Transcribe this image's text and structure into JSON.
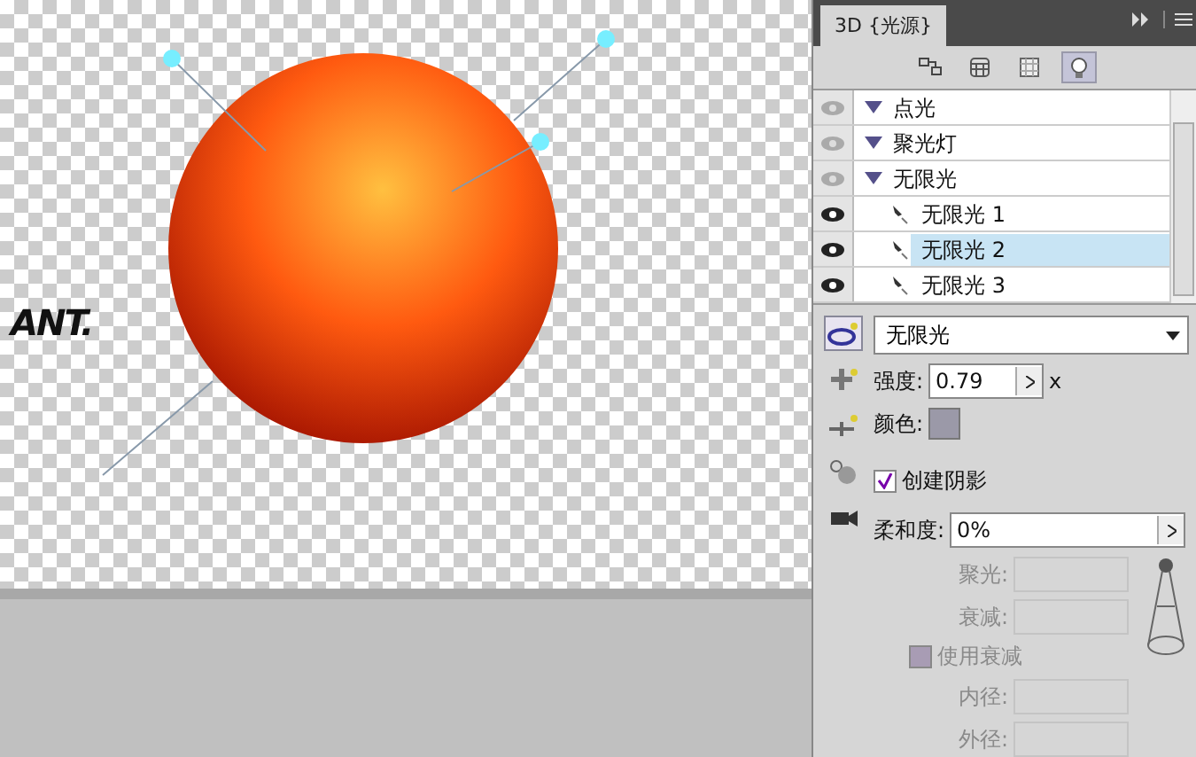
{
  "canvas": {
    "logo": "ANT."
  },
  "panel": {
    "title": "3D {光源}",
    "toolbar": [
      {
        "selected": false
      },
      {
        "selected": false
      },
      {
        "selected": false
      },
      {
        "selected": true
      }
    ],
    "tree": [
      {
        "label": "点光",
        "expanded": true,
        "visible": false
      },
      {
        "label": "聚光灯",
        "expanded": true,
        "visible": false
      },
      {
        "label": "无限光",
        "expanded": true,
        "visible": false,
        "children": [
          {
            "label": "无限光 1",
            "visible": true,
            "selected": false
          },
          {
            "label": "无限光 2",
            "visible": true,
            "selected": true
          },
          {
            "label": "无限光 3",
            "visible": true,
            "selected": false
          }
        ]
      }
    ],
    "side_tools": [
      {
        "selected": true
      },
      {
        "selected": false
      },
      {
        "selected": false
      },
      {
        "selected": false
      },
      {
        "selected": false
      }
    ],
    "light_type": "无限光",
    "intensity": {
      "label": "强度:",
      "value": "0.79",
      "suffix": "x"
    },
    "color": {
      "label": "颜色:",
      "color": "#9b99a8"
    },
    "shadow": {
      "label": "创建阴影",
      "checked": true
    },
    "softness": {
      "label": "柔和度:",
      "value": "0%"
    },
    "spot_fields": [
      {
        "label": "聚光:",
        "disabled": true
      },
      {
        "label": "衰减:",
        "disabled": true
      }
    ],
    "falloff": {
      "label": "使用衰减",
      "checked": false,
      "disabled": true
    },
    "radius_fields": [
      {
        "label": "内径:",
        "disabled": true
      },
      {
        "label": "外径:",
        "disabled": true
      }
    ]
  }
}
